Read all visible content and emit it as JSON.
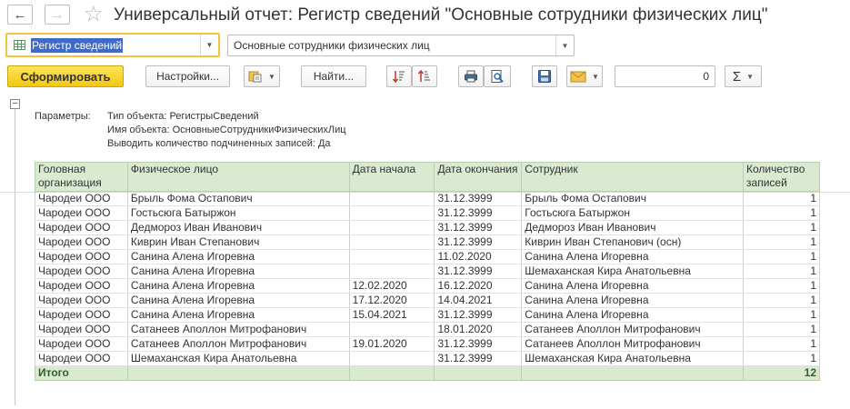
{
  "window": {
    "back_icon": "arrow-left-icon",
    "forward_icon": "arrow-right-icon",
    "favorite_icon": "star-icon",
    "title": "Универсальный отчет: Регистр сведений \"Основные сотрудники физических лиц\""
  },
  "selectors": {
    "object_type": "Регистр сведений",
    "object_name": "Основные сотрудники физических лиц"
  },
  "toolbar": {
    "generate": "Сформировать",
    "settings": "Настройки...",
    "find": "Найти...",
    "amount_value": "0",
    "sum_symbol": "Σ"
  },
  "params": {
    "label": "Параметры:",
    "lines": [
      "Тип объекта: РегистрыСведений",
      "Имя объекта: ОсновныеСотрудникиФизическихЛиц",
      "Выводить количество подчиненных записей: Да"
    ]
  },
  "table": {
    "headers": [
      "Головная организация",
      "Физическое лицо",
      "Дата начала",
      "Дата окончания",
      "Сотрудник",
      "Количество записей"
    ],
    "rows": [
      [
        "Чародеи ООО",
        "Брыль Фома Остапович",
        "",
        "31.12.3999",
        "Брыль Фома Остапович",
        "1"
      ],
      [
        "Чародеи ООО",
        "Гостьсюга Батыржон",
        "",
        "31.12.3999",
        "Гостьсюга Батыржон",
        "1"
      ],
      [
        "Чародеи ООО",
        "Дедмороз Иван Иванович",
        "",
        "31.12.3999",
        "Дедмороз Иван Иванович",
        "1"
      ],
      [
        "Чародеи ООО",
        "Киврин Иван Степанович",
        "",
        "31.12.3999",
        "Киврин Иван Степанович (осн)",
        "1"
      ],
      [
        "Чародеи ООО",
        "Санина Алена Игоревна",
        "",
        "11.02.2020",
        "Санина Алена Игоревна",
        "1"
      ],
      [
        "Чародеи ООО",
        "Санина Алена Игоревна",
        "",
        "31.12.3999",
        "Шемаханская Кира Анатольевна",
        "1"
      ],
      [
        "Чародеи ООО",
        "Санина Алена Игоревна",
        "12.02.2020",
        "16.12.2020",
        "Санина Алена Игоревна",
        "1"
      ],
      [
        "Чародеи ООО",
        "Санина Алена Игоревна",
        "17.12.2020",
        "14.04.2021",
        "Санина Алена Игоревна",
        "1"
      ],
      [
        "Чародеи ООО",
        "Санина Алена Игоревна",
        "15.04.2021",
        "31.12.3999",
        "Санина Алена Игоревна",
        "1"
      ],
      [
        "Чародеи ООО",
        "Сатанеев Аполлон Митрофанович",
        "",
        "18.01.2020",
        "Сатанеев Аполлон Митрофанович",
        "1"
      ],
      [
        "Чародеи ООО",
        "Сатанеев Аполлон Митрофанович",
        "19.01.2020",
        "31.12.3999",
        "Сатанеев Аполлон Митрофанович",
        "1"
      ],
      [
        "Чародеи ООО",
        "Шемаханская Кира Анатольевна",
        "",
        "31.12.3999",
        "Шемаханская Кира Анатольевна",
        "1"
      ]
    ],
    "total_label": "Итого",
    "total_value": "12"
  }
}
